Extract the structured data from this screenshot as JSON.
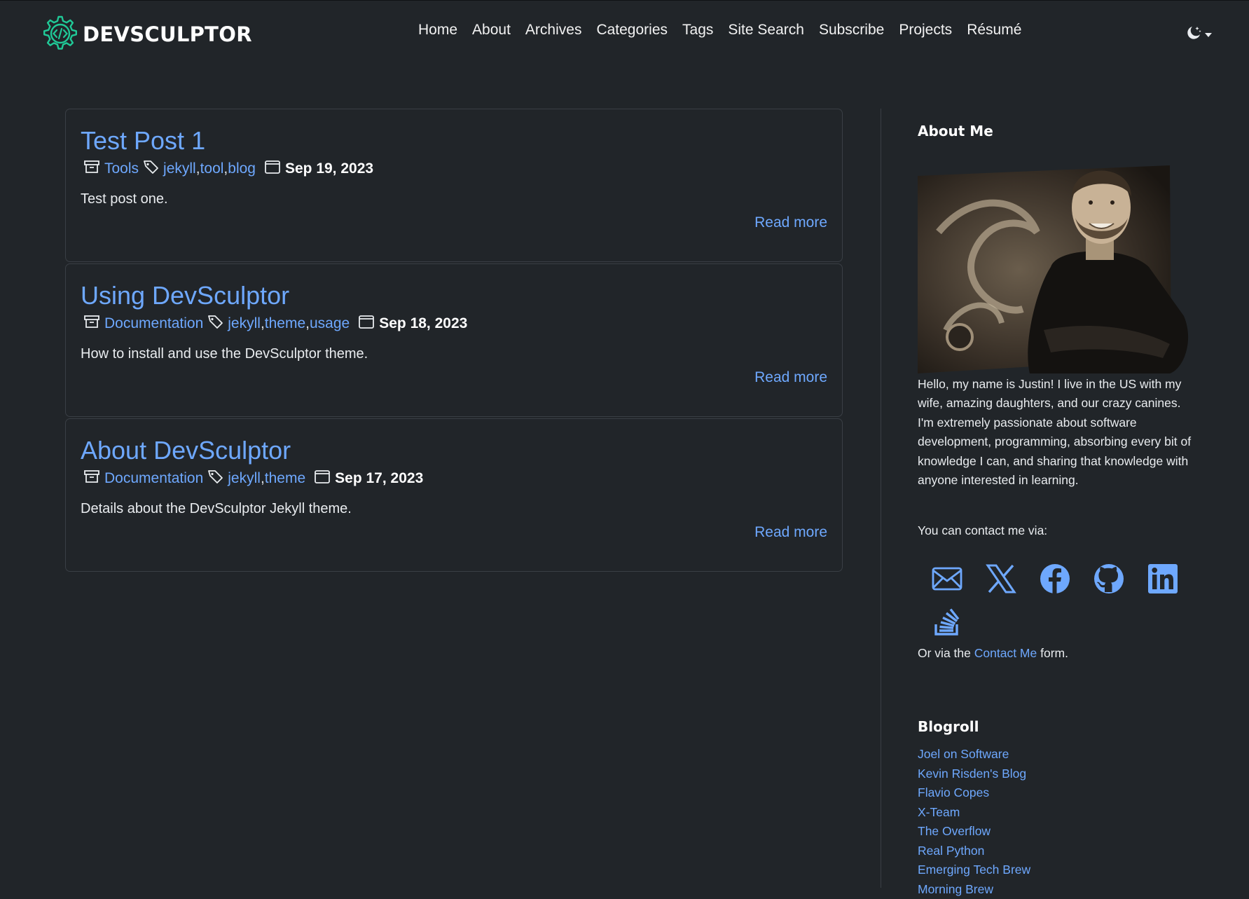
{
  "brand": {
    "name": "DEVSCULPTOR"
  },
  "nav": {
    "items": [
      {
        "label": "Home"
      },
      {
        "label": "About"
      },
      {
        "label": "Archives"
      },
      {
        "label": "Categories"
      },
      {
        "label": "Tags"
      },
      {
        "label": "Site Search"
      },
      {
        "label": "Subscribe"
      },
      {
        "label": "Projects"
      },
      {
        "label": "Résumé"
      }
    ],
    "theme_icon": "moon-stars-icon"
  },
  "colors": {
    "background": "#212529",
    "link": "#6ea8fe",
    "brand_accent": "#20c997",
    "text": "#dee2e6"
  },
  "posts": [
    {
      "title": "Test Post 1",
      "category": "Tools",
      "tags": [
        "jekyll",
        "tool",
        "blog"
      ],
      "date": "Sep 19, 2023",
      "excerpt": "Test post one.",
      "read_more": "Read more"
    },
    {
      "title": "Using DevSculptor",
      "category": "Documentation",
      "tags": [
        "jekyll",
        "theme",
        "usage"
      ],
      "date": "Sep 18, 2023",
      "excerpt": "How to install and use the DevSculptor theme.",
      "read_more": "Read more"
    },
    {
      "title": "About DevSculptor",
      "category": "Documentation",
      "tags": [
        "jekyll",
        "theme"
      ],
      "date": "Sep 17, 2023",
      "excerpt": "Details about the DevSculptor Jekyll theme.",
      "read_more": "Read more"
    }
  ],
  "sidebar": {
    "about_heading": "About Me",
    "about_text": "Hello, my name is Justin! I live in the US with my wife, amazing daughters, and our crazy canines. I'm extremely passionate about software development, programming, absorbing every bit of knowledge I can, and sharing that knowledge with anyone interested in learning.",
    "contact_intro": "You can contact me via:",
    "social_icons": [
      "envelope-icon",
      "x-twitter-icon",
      "facebook-icon",
      "github-icon",
      "linkedin-icon",
      "stack-overflow-icon"
    ],
    "contact_form": {
      "prefix": "Or via the",
      "link": "Contact Me",
      "suffix": "form."
    },
    "blogroll_heading": "Blogroll",
    "blogroll": [
      "Joel on Software",
      "Kevin Risden's Blog",
      "Flavio Copes",
      "X-Team",
      "The Overflow",
      "Real Python",
      "Emerging Tech Brew",
      "Morning Brew"
    ]
  }
}
